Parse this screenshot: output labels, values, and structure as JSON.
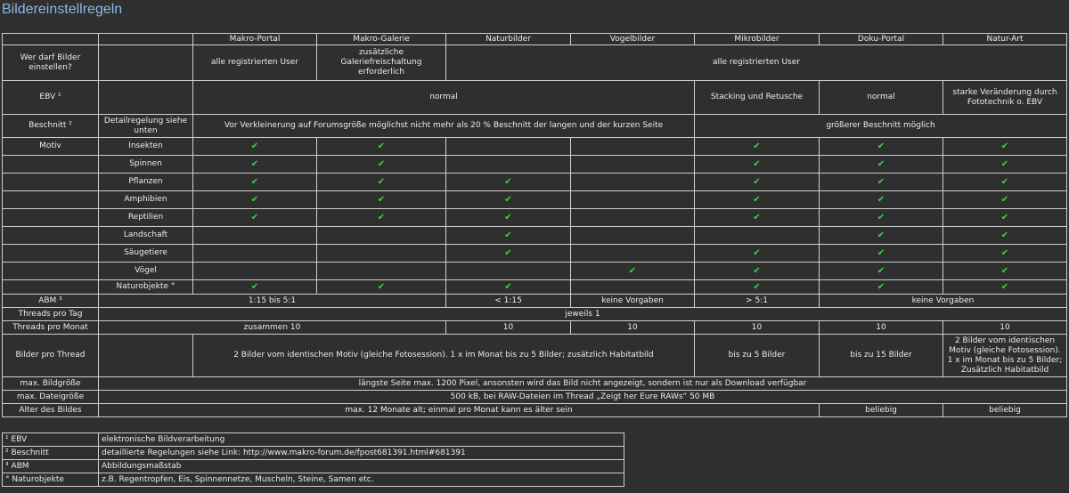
{
  "title": "Bildereinstellregeln",
  "check_color": "#3fd04a",
  "check_icon": "check-mark-icon",
  "portals": [
    "Makro-Portal",
    "Makro-Galerie",
    "Naturbilder",
    "Vogelbilder",
    "Mikrobilder",
    "Doku-Portal",
    "Natur-Art"
  ],
  "rows": {
    "wer": {
      "label": "Wer darf Bilder einstellen?",
      "makro_portal": "alle registrierten User",
      "makro_galerie": "zusätzliche Galeriefreischaltung erforderlich",
      "rest": "alle registrierten User"
    },
    "ebv": {
      "label": "EBV ¹",
      "normal": "normal",
      "mikro": "Stacking und Retusche",
      "doku": "normal",
      "natur_art": "starke Veränderung durch Fototechnik o. EBV"
    },
    "beschnitt": {
      "label": "Beschnitt ²",
      "sub": "Detailregelung siehe unten",
      "main": "Vor Verkleinerung auf Forumsgröße möglichst nicht mehr als 20 % Beschnitt der langen und der kurzen Seite",
      "rest": "größerer Beschnitt möglich"
    },
    "motiv": {
      "label": "Motiv",
      "items": [
        {
          "name": "Insekten",
          "checks": [
            1,
            1,
            0,
            0,
            1,
            1,
            1
          ]
        },
        {
          "name": "Spinnen",
          "checks": [
            1,
            1,
            0,
            0,
            1,
            1,
            1
          ]
        },
        {
          "name": "Pflanzen",
          "checks": [
            1,
            1,
            1,
            0,
            1,
            1,
            1
          ]
        },
        {
          "name": "Amphibien",
          "checks": [
            1,
            1,
            1,
            0,
            1,
            1,
            1
          ]
        },
        {
          "name": "Reptilien",
          "checks": [
            1,
            1,
            1,
            0,
            1,
            1,
            1
          ]
        },
        {
          "name": "Landschaft",
          "checks": [
            0,
            0,
            1,
            0,
            0,
            1,
            1
          ]
        },
        {
          "name": "Säugetiere",
          "checks": [
            0,
            0,
            1,
            0,
            1,
            1,
            1
          ]
        },
        {
          "name": "Vögel",
          "checks": [
            0,
            0,
            0,
            1,
            1,
            1,
            1
          ]
        },
        {
          "name": "Naturobjekte °",
          "checks": [
            1,
            1,
            1,
            0,
            1,
            1,
            1
          ]
        }
      ]
    },
    "abm": {
      "label": "ABM ³",
      "makro": "1:15 bis 5:1",
      "natur": "< 1:15",
      "vogel": "keine Vorgaben",
      "mikro": "> 5:1",
      "rest": "keine Vorgaben"
    },
    "threads_tag": {
      "label": "Threads pro Tag",
      "value": "jeweils 1"
    },
    "threads_monat": {
      "label": "Threads pro Monat",
      "makro": "zusammen 10",
      "natur": "10",
      "vogel": "10",
      "mikro": "10",
      "doku": "10",
      "natur_art": "10"
    },
    "bilder_thread": {
      "label": "Bilder pro Thread",
      "main": "2 Bilder vom identischen Motiv (gleiche Fotosession). 1 x im Monat bis zu 5 Bilder; zusätzlich Habitatbild",
      "mikro": "bis zu 5 Bilder",
      "doku": "bis zu 15 Bilder",
      "natur_art": "2 Bilder vom identischen Motiv (gleiche Fotosession). 1 x im Monat bis zu 5 Bilder; Zusätzlich Habitatbild"
    },
    "bildgroesse": {
      "label": "max. Bildgröße",
      "value": "längste Seite max. 1200 Pixel, ansonsten wird das Bild nicht angezeigt, sondern ist nur als Download verfügbar"
    },
    "dateigroesse": {
      "label": "max. Dateigröße",
      "value": "500 kB, bei RAW-Dateien im Thread „Zeigt her Eure RAWs“ 50 MB"
    },
    "alter": {
      "label": "Alter des Bildes",
      "main": "max. 12 Monate alt; einmal pro Monat kann es älter sein",
      "doku": "beliebig",
      "natur_art": "beliebig"
    }
  },
  "legend": [
    {
      "key": "¹ EBV",
      "value": "elektronische Bildverarbeitung"
    },
    {
      "key": "² Beschnitt",
      "value": "detaillierte Regelungen siehe Link: http://www.makro-forum.de/fpost681391.html#681391"
    },
    {
      "key": "³ ABM",
      "value": "Abbildungsmaßstab"
    },
    {
      "key": "° Naturobjekte",
      "value": "z.B. Regentropfen, Eis, Spinnennetze, Muscheln, Steine, Samen etc."
    }
  ]
}
